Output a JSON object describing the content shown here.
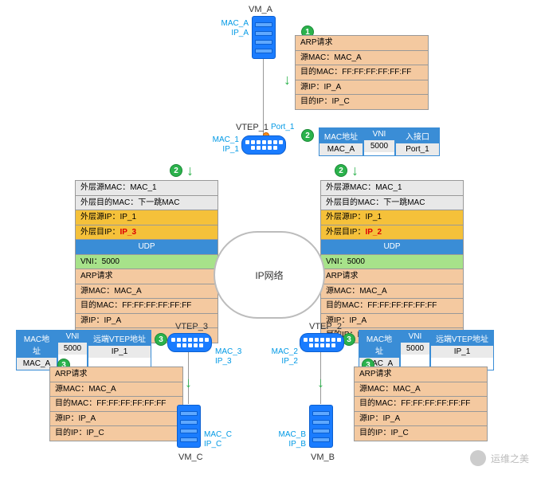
{
  "vm_a": {
    "name": "VM_A",
    "mac": "MAC_A",
    "ip": "IP_A"
  },
  "vm_b": {
    "name": "VM_B",
    "mac": "MAC_B",
    "ip": "IP_B"
  },
  "vm_c": {
    "name": "VM_C",
    "mac": "MAC_C",
    "ip": "IP_C"
  },
  "vtep1": {
    "name": "VTEP_1",
    "mac": "MAC_1",
    "ip": "IP_1",
    "port": "Port_1"
  },
  "vtep2": {
    "name": "VTEP_2",
    "mac": "MAC_2",
    "ip": "IP_2"
  },
  "vtep3": {
    "name": "VTEP_3",
    "mac": "MAC_3",
    "ip": "IP_3"
  },
  "cloud": "IP网络",
  "arp1": {
    "title": "ARP请求",
    "l1": "源MAC：MAC_A",
    "l2": "目的MAC：FF:FF:FF:FF:FF:FF",
    "l3": "源IP：IP_A",
    "l4": "目的IP：IP_C"
  },
  "encL": {
    "eth1": "外层源MAC：MAC_1",
    "eth2": "外层目的MAC：下一跳MAC",
    "ip1": "外层源IP：IP_1",
    "ip2a": "外层目IP：",
    "ip2b": "IP_3",
    "udp": "UDP",
    "vni": "VNI：5000"
  },
  "encR": {
    "eth1": "外层源MAC：MAC_1",
    "eth2": "外层目的MAC：下一跳MAC",
    "ip1": "外层源IP：IP_1",
    "ip2a": "外层目IP：",
    "ip2b": "IP_2",
    "udp": "UDP",
    "vni": "VNI：5000"
  },
  "tblTop": {
    "h1": "MAC地址",
    "h2": "VNI",
    "h3": "入接口",
    "d1": "MAC_A",
    "d2": "5000",
    "d3": "Port_1"
  },
  "tblBL": {
    "h1": "MAC地址",
    "h2": "VNI",
    "h3": "远端VTEP地址",
    "d1": "MAC_A",
    "d2": "5000",
    "d3": "IP_1"
  },
  "tblBR": {
    "h1": "MAC地址",
    "h2": "VNI",
    "h3": "远端VTEP地址",
    "d1": "MAC_A",
    "d2": "5000",
    "d3": "IP_1"
  },
  "step": {
    "s1": "1",
    "s2": "2",
    "s3": "3"
  },
  "watermark": "运维之美"
}
